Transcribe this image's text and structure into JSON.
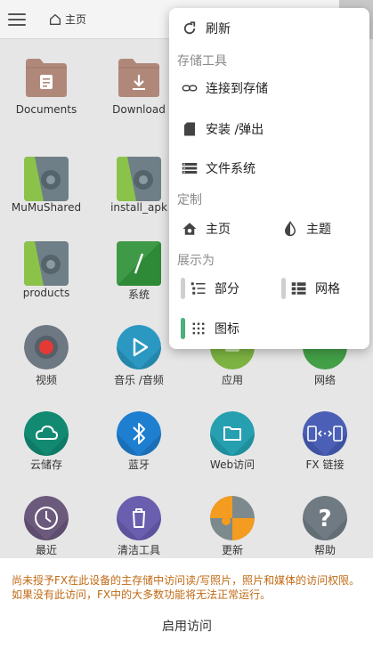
{
  "topbar": {
    "home_label": "主页"
  },
  "grid": {
    "row1": [
      "Documents",
      "Download"
    ],
    "row2": [
      "MuMuShared",
      "install_apk"
    ],
    "row3": [
      "products",
      "系统"
    ],
    "row4": [
      "视频",
      "音乐 /音频",
      "应用",
      "网络"
    ],
    "row5": [
      "云储存",
      "蓝牙",
      "Web访问",
      "FX 链接"
    ],
    "row6": [
      "最近",
      "清洁工具",
      "更新",
      "帮助"
    ]
  },
  "menu": {
    "refresh": "刷新",
    "storage_tools": "存储工具",
    "connect_storage": "连接到存储",
    "mount_eject": "安装 /弹出",
    "file_system": "文件系统",
    "customize": "定制",
    "home": "主页",
    "theme": "主题",
    "display_as": "展示为",
    "partial": "部分",
    "grid": "网格",
    "icons": "图标"
  },
  "colors": {
    "accent": "#4caf7d",
    "warning_text": "#c06a14",
    "folder": "#b0887a"
  },
  "banner": {
    "message": "尚未授予FX在此设备的主存储中访问读/写照片，照片和媒体的访问权限。如果没有此访问，FX中的大多数功能将无法正常运行。",
    "button": "启用访问"
  }
}
